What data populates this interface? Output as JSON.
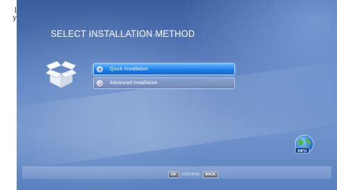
{
  "page_edge": {
    "lines": [
      "l",
      "y"
    ]
  },
  "screen": {
    "title": "SELECT INSTALLATION METHOD",
    "menu": [
      {
        "label": "Quick Installation",
        "selected": true
      },
      {
        "label": "Advanced Installation",
        "selected": false
      }
    ],
    "info_label": "INFO",
    "bottom": {
      "ok_key": "OK",
      "continue_label": "CONTINUE",
      "back_key": "BACK"
    }
  },
  "colors": {
    "background": "#5f84c2",
    "selected_item": "#1e7ee8",
    "inactive_item": "#8a9cc4"
  }
}
